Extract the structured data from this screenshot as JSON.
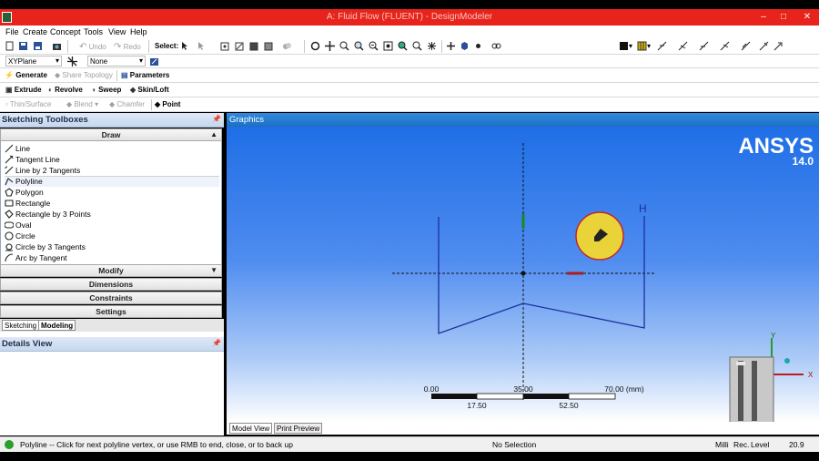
{
  "window": {
    "title": "A: Fluid Flow (FLUENT) - DesignModeler",
    "buttons": {
      "minimize": "–",
      "maximize": "□",
      "close": "✕"
    }
  },
  "menu": [
    "File",
    "Create",
    "Concept",
    "Tools",
    "View",
    "Help"
  ],
  "toolbar": {
    "undo": "Undo",
    "redo": "Redo",
    "select": "Select:"
  },
  "plane_toolbar": {
    "plane": "XYPlane",
    "sketch": "None"
  },
  "feature_toolbar": {
    "generate": "Generate",
    "share_topology": "Share Topology",
    "parameters": "Parameters"
  },
  "create_toolbar": {
    "extrude": "Extrude",
    "revolve": "Revolve",
    "sweep": "Sweep",
    "skin_loft": "Skin/Loft"
  },
  "modify_toolbar": {
    "thin_surface": "Thin/Surface",
    "blend": "Blend",
    "chamfer": "Chamfer",
    "point": "Point"
  },
  "sketching_toolboxes": {
    "title": "Sketching Toolboxes",
    "draw_label": "Draw",
    "draw_items": [
      "Line",
      "Tangent Line",
      "Line by 2 Tangents",
      "Polyline",
      "Polygon",
      "Rectangle",
      "Rectangle by 3 Points",
      "Oval",
      "Circle",
      "Circle by 3 Tangents",
      "Arc by Tangent"
    ],
    "selected_item": "Polyline",
    "groups": [
      "Modify",
      "Dimensions",
      "Constraints",
      "Settings"
    ]
  },
  "left_tabs": {
    "sketching": "Sketching",
    "modeling": "Modeling"
  },
  "details_view": {
    "title": "Details View"
  },
  "graphics": {
    "title": "Graphics",
    "logo": "ANSYS",
    "version": "14.0",
    "constraint_marker": "H",
    "ruler": {
      "top_labels": [
        "0.00",
        "35.00",
        "70.00 (mm)"
      ],
      "bottom_labels": [
        "17.50",
        "52.50"
      ]
    }
  },
  "view_tabs": {
    "model_view": "Model View",
    "print_preview": "Print Preview"
  },
  "status": {
    "message": "Polyline -- Click for next polyline vertex, or use RMB to end, close, or to back up",
    "selection": "No Selection",
    "units": "Milli",
    "rec": "Rec.",
    "level": "Level",
    "value": "20.9"
  },
  "colors": {
    "title_bar": "#e8231b",
    "panel_header": "#c6d7ee",
    "graphics_header": "#1e6fc4",
    "viewport_top": "#1f6ee6",
    "sketch_line": "#1c2fa0"
  }
}
